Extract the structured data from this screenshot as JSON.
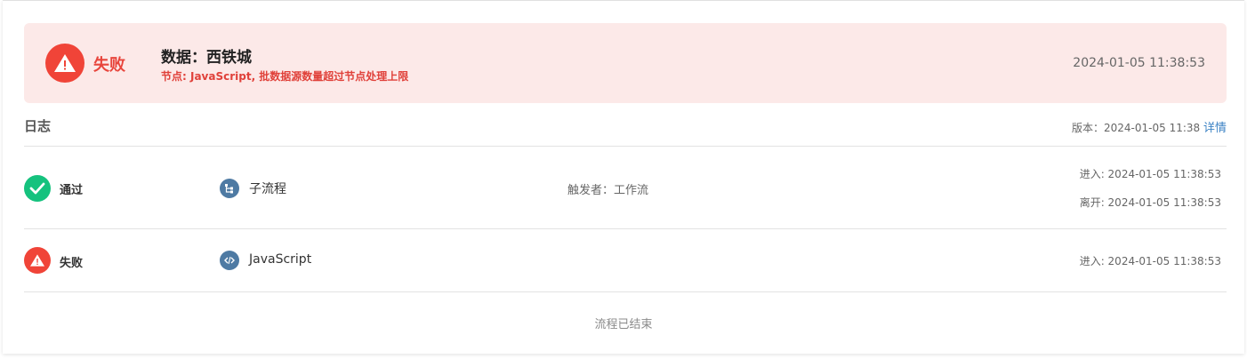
{
  "banner": {
    "status": "失败",
    "title": "数据：西铁城",
    "subtitle": "节点: JavaScript, 批数据源数量超过节点处理上限",
    "time": "2024-01-05 11:38:53"
  },
  "log": {
    "title": "日志",
    "version_label": "版本：2024-01-05 11:38",
    "detail_link": "详情"
  },
  "rows": [
    {
      "status": "通过",
      "node": "子流程",
      "trigger": "触发者：工作流",
      "enter": "进入: 2024-01-05 11:38:53",
      "leave": "离开: 2024-01-05 11:38:53"
    },
    {
      "status": "失败",
      "node": "JavaScript",
      "enter": "进入: 2024-01-05 11:38:53"
    }
  ],
  "footer": "流程已结束",
  "colors": {
    "fail": "#f04438",
    "success": "#15c27e",
    "node_icon": "#4e7aa3",
    "banner_bg": "#fce9e8",
    "link": "#3b82c4"
  },
  "icons": {
    "fail": "warning-triangle-icon",
    "success": "check-icon",
    "subflow": "subflow-icon",
    "code": "code-icon"
  }
}
